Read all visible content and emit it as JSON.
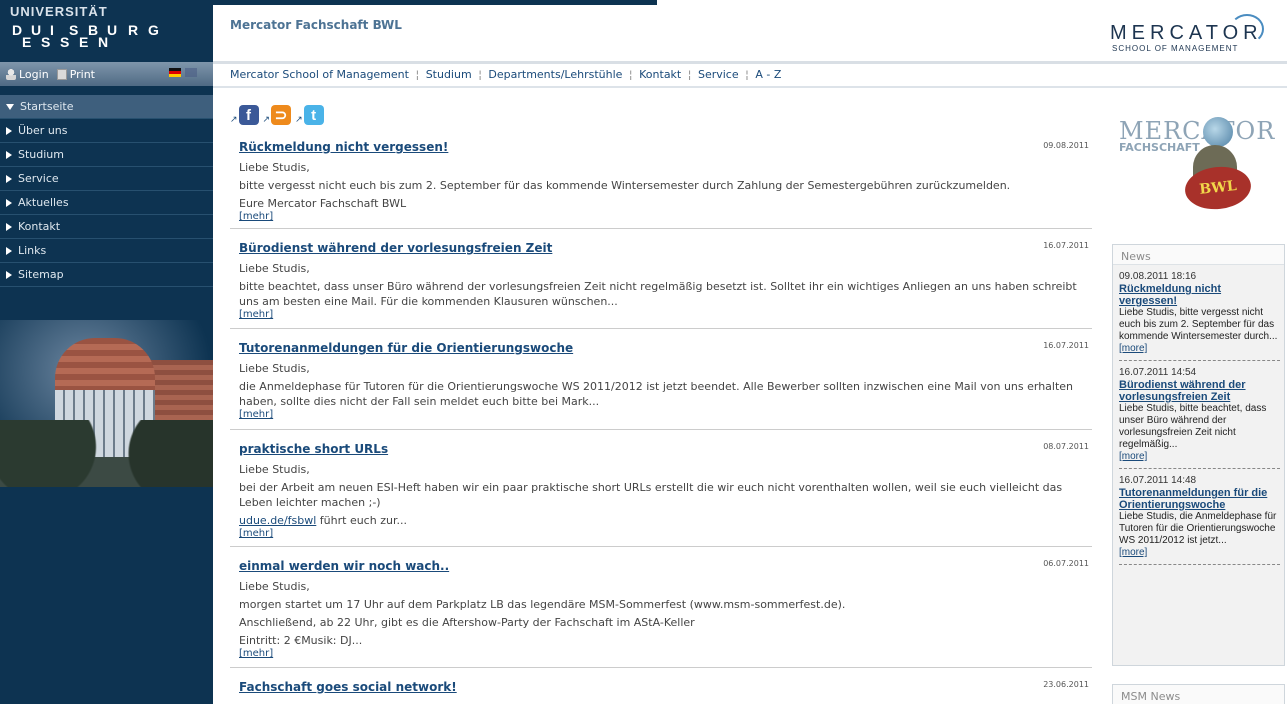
{
  "university": {
    "line1": "UNIVERSITÄT",
    "letters_top": [
      "D",
      "U",
      "I",
      "S",
      "B",
      "U",
      "R",
      "G"
    ],
    "letters_bottom": [
      "E",
      "S",
      "S",
      "E",
      "N"
    ]
  },
  "userbar": {
    "login": "Login",
    "print": "Print"
  },
  "nav": [
    {
      "label": "Startseite",
      "active": true
    },
    {
      "label": "Über uns"
    },
    {
      "label": "Studium"
    },
    {
      "label": "Service"
    },
    {
      "label": "Aktuelles"
    },
    {
      "label": "Kontakt"
    },
    {
      "label": "Links"
    },
    {
      "label": "Sitemap"
    }
  ],
  "header": {
    "site_title": "Mercator Fachschaft BWL",
    "logo_word": "MERCATOR",
    "logo_sub": "SCHOOL OF MANAGEMENT"
  },
  "breadcrumb": {
    "items": [
      "Mercator School of Management",
      "Studium",
      "Departments/Lehrstühle",
      "Kontakt",
      "Service",
      "A - Z"
    ],
    "separator": "¦"
  },
  "social": {
    "ext": "↗",
    "fb": "f",
    "rss": "⊃",
    "tw": "t"
  },
  "news": [
    {
      "title": "Rückmeldung nicht vergessen!",
      "date": "09.08.2011",
      "lines": [
        "Liebe Studis,",
        "bitte vergesst nicht euch bis zum 2. September für das kommende Wintersemester durch Zahlung der Semestergebühren zurückzumelden.",
        "Eure Mercator Fachschaft BWL"
      ],
      "more": "[mehr]"
    },
    {
      "title": "Bürodienst während der vorlesungsfreien Zeit",
      "date": "16.07.2011",
      "lines": [
        "Liebe Studis,",
        "bitte beachtet, dass unser Büro während der vorlesungsfreien Zeit nicht regelmäßig besetzt ist. Solltet ihr ein wichtiges Anliegen an uns haben schreibt uns am besten eine Mail. Für die kommenden Klausuren wünschen..."
      ],
      "more": "[mehr]"
    },
    {
      "title": "Tutorenanmeldungen für die Orientierungswoche",
      "date": "16.07.2011",
      "lines": [
        "Liebe Studis,",
        "die Anmeldephase für Tutoren für die Orientierungswoche WS 2011/2012 ist jetzt beendet. Alle Bewerber sollten inzwischen eine Mail von uns erhalten haben, sollte dies nicht der Fall sein meldet euch bitte bei Mark..."
      ],
      "more": "[mehr]"
    },
    {
      "title": "praktische short URLs",
      "date": "08.07.2011",
      "lines": [
        "Liebe Studis,",
        "bei der Arbeit am neuen ESI-Heft haben wir ein paar praktische short URLs erstellt die wir euch nicht vorenthalten wollen, weil sie euch vielleicht das Leben leichter machen ;-)"
      ],
      "link": "udue.de/fsbwl",
      "link_suffix": " führt euch zur...",
      "more": "[mehr]"
    },
    {
      "title": "einmal werden wir noch wach..",
      "date": "06.07.2011",
      "lines": [
        "Liebe Studis,",
        "morgen startet um 17 Uhr auf dem Parkplatz LB das legendäre MSM-Sommerfest (www.msm-sommerfest.de).",
        "Anschließend, ab 22 Uhr, gibt es die Aftershow-Party der Fachschaft im AStA-Keller",
        "Eintritt: 2 €Musik: DJ..."
      ],
      "more": "[mehr]"
    },
    {
      "title": "Fachschaft goes social network!",
      "date": "23.06.2011",
      "lines": [],
      "more": ""
    }
  ],
  "fs_logo": {
    "word1": "MERCATOR",
    "word2": "FACHSCHAFT",
    "badge": "BWL"
  },
  "sidebox_news": {
    "header": "News",
    "items": [
      {
        "date": "09.08.2011 18:16",
        "title": "Rückmeldung nicht vergessen!",
        "text": "Liebe Studis, bitte vergesst nicht euch bis zum 2. September für das kommende Wintersemester durch...",
        "more": "[more]"
      },
      {
        "date": "16.07.2011 14:54",
        "title": "Bürodienst während der vorlesungsfreien Zeit",
        "text": "Liebe Studis, bitte beachtet, dass unser Büro während der vorlesungsfreien Zeit nicht regelmäßig...",
        "more": "[more]"
      },
      {
        "date": "16.07.2011 14:48",
        "title": "Tutorenanmeldungen für die Orientierungswoche",
        "text": "Liebe Studis, die Anmeldephase für Tutoren für die Orientierungswoche WS 2011/2012 ist jetzt...",
        "more": "[more]"
      }
    ]
  },
  "sidebox_msm": {
    "header": "MSM News"
  }
}
